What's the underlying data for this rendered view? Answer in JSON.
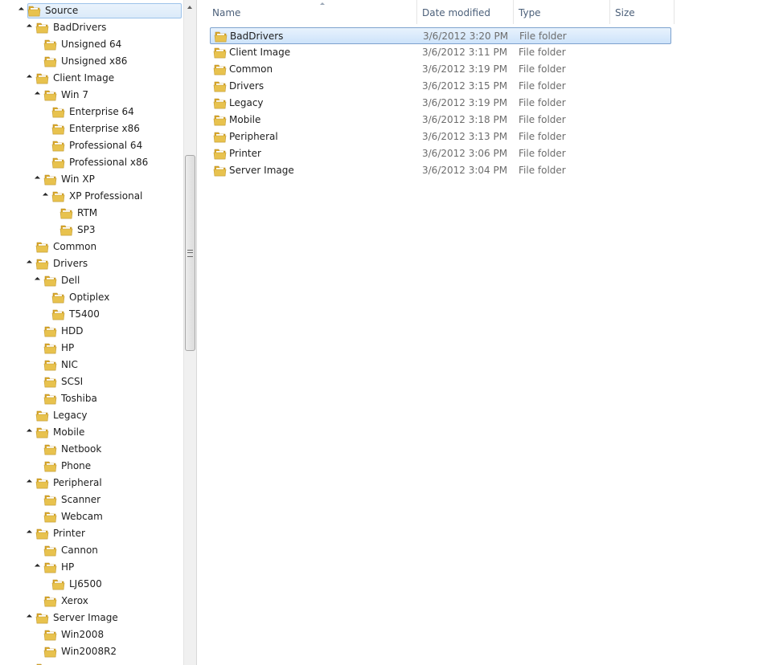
{
  "colors": {
    "folder": "#e8c24e",
    "selection_fill": "#dbeaf9",
    "selection_border": "#7da2ce",
    "header_text": "#4c607a",
    "secondary_text": "#6d6d6d"
  },
  "nav": {
    "items": [
      {
        "label": "Source",
        "level": 0,
        "expanded": true,
        "selected": true
      },
      {
        "label": "BadDrivers",
        "level": 1,
        "expanded": true
      },
      {
        "label": "Unsigned 64",
        "level": 2
      },
      {
        "label": "Unsigned x86",
        "level": 2
      },
      {
        "label": "Client Image",
        "level": 1,
        "expanded": true
      },
      {
        "label": "Win 7",
        "level": 2,
        "expanded": true
      },
      {
        "label": "Enterprise 64",
        "level": 3
      },
      {
        "label": "Enterprise x86",
        "level": 3
      },
      {
        "label": "Professional 64",
        "level": 3
      },
      {
        "label": "Professional x86",
        "level": 3
      },
      {
        "label": "Win XP",
        "level": 2,
        "expanded": true
      },
      {
        "label": "XP Professional",
        "level": 3,
        "expanded": true
      },
      {
        "label": "RTM",
        "level": 4
      },
      {
        "label": "SP3",
        "level": 4
      },
      {
        "label": "Common",
        "level": 1
      },
      {
        "label": "Drivers",
        "level": 1,
        "expanded": true
      },
      {
        "label": "Dell",
        "level": 2,
        "expanded": true
      },
      {
        "label": "Optiplex",
        "level": 3
      },
      {
        "label": "T5400",
        "level": 3
      },
      {
        "label": "HDD",
        "level": 2
      },
      {
        "label": "HP",
        "level": 2
      },
      {
        "label": "NIC",
        "level": 2
      },
      {
        "label": "SCSI",
        "level": 2
      },
      {
        "label": "Toshiba",
        "level": 2
      },
      {
        "label": "Legacy",
        "level": 1
      },
      {
        "label": "Mobile",
        "level": 1,
        "expanded": true
      },
      {
        "label": "Netbook",
        "level": 2
      },
      {
        "label": "Phone",
        "level": 2
      },
      {
        "label": "Peripheral",
        "level": 1,
        "expanded": true
      },
      {
        "label": "Scanner",
        "level": 2
      },
      {
        "label": "Webcam",
        "level": 2
      },
      {
        "label": "Printer",
        "level": 1,
        "expanded": true
      },
      {
        "label": "Cannon",
        "level": 2
      },
      {
        "label": "HP",
        "level": 2,
        "expanded": true
      },
      {
        "label": "LJ6500",
        "level": 3
      },
      {
        "label": "Xerox",
        "level": 2
      },
      {
        "label": "Server Image",
        "level": 1,
        "expanded": true
      },
      {
        "label": "Win2008",
        "level": 2
      },
      {
        "label": "Win2008R2",
        "level": 2
      },
      {
        "label": "",
        "level": 1
      }
    ]
  },
  "columns": {
    "name": "Name",
    "date": "Date modified",
    "type": "Type",
    "size": "Size"
  },
  "files": [
    {
      "name": "BadDrivers",
      "date": "3/6/2012 3:20 PM",
      "type": "File folder",
      "selected": true
    },
    {
      "name": "Client Image",
      "date": "3/6/2012 3:11 PM",
      "type": "File folder"
    },
    {
      "name": "Common",
      "date": "3/6/2012 3:19 PM",
      "type": "File folder"
    },
    {
      "name": "Drivers",
      "date": "3/6/2012 3:15 PM",
      "type": "File folder"
    },
    {
      "name": "Legacy",
      "date": "3/6/2012 3:19 PM",
      "type": "File folder"
    },
    {
      "name": "Mobile",
      "date": "3/6/2012 3:18 PM",
      "type": "File folder"
    },
    {
      "name": "Peripheral",
      "date": "3/6/2012 3:13 PM",
      "type": "File folder"
    },
    {
      "name": "Printer",
      "date": "3/6/2012 3:06 PM",
      "type": "File folder"
    },
    {
      "name": "Server Image",
      "date": "3/6/2012 3:04 PM",
      "type": "File folder"
    }
  ]
}
